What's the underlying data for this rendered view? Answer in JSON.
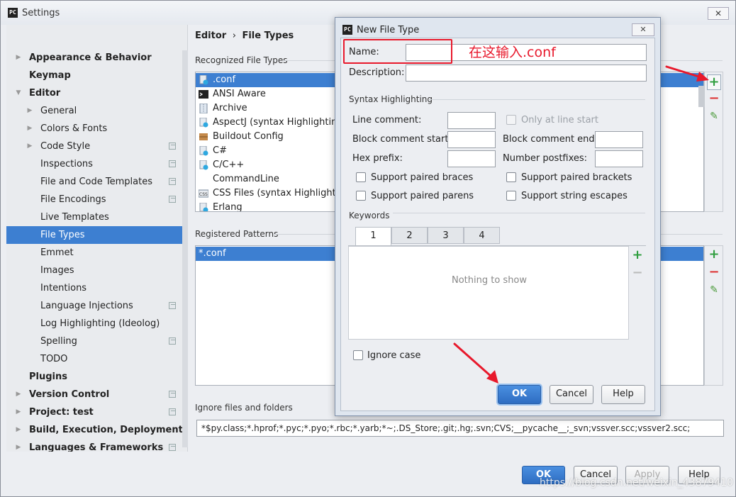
{
  "window": {
    "title": "Settings",
    "app_icon": "PC"
  },
  "search": {
    "placeholder": ""
  },
  "sidebar": {
    "items": [
      {
        "label": "Appearance & Behavior",
        "bold": true,
        "arrow": "right",
        "level": 0
      },
      {
        "label": "Keymap",
        "bold": true,
        "arrow": "",
        "level": 0
      },
      {
        "label": "Editor",
        "bold": true,
        "arrow": "down",
        "level": 0
      },
      {
        "label": "General",
        "arrow": "right",
        "level": 1
      },
      {
        "label": "Colors & Fonts",
        "arrow": "right",
        "level": 1
      },
      {
        "label": "Code Style",
        "arrow": "right",
        "level": 1,
        "copy": true
      },
      {
        "label": "Inspections",
        "level": 1,
        "copy": true
      },
      {
        "label": "File and Code Templates",
        "level": 1,
        "copy": true
      },
      {
        "label": "File Encodings",
        "level": 1,
        "copy": true
      },
      {
        "label": "Live Templates",
        "level": 1
      },
      {
        "label": "File Types",
        "level": 1,
        "selected": true
      },
      {
        "label": "Emmet",
        "level": 1
      },
      {
        "label": "Images",
        "level": 1
      },
      {
        "label": "Intentions",
        "level": 1
      },
      {
        "label": "Language Injections",
        "level": 1,
        "copy": true
      },
      {
        "label": "Log Highlighting (Ideolog)",
        "level": 1
      },
      {
        "label": "Spelling",
        "level": 1,
        "copy": true
      },
      {
        "label": "TODO",
        "level": 1
      },
      {
        "label": "Plugins",
        "bold": true,
        "level": 0
      },
      {
        "label": "Version Control",
        "bold": true,
        "arrow": "right",
        "level": 0,
        "copy": true
      },
      {
        "label": "Project: test",
        "bold": true,
        "arrow": "right",
        "level": 0,
        "copy": true
      },
      {
        "label": "Build, Execution, Deployment",
        "bold": true,
        "arrow": "right",
        "level": 0
      },
      {
        "label": "Languages & Frameworks",
        "bold": true,
        "arrow": "right",
        "level": 0,
        "copy": true
      }
    ]
  },
  "main": {
    "breadcrumb_parent": "Editor",
    "breadcrumb_sep": "›",
    "breadcrumb_current": "File Types",
    "recognized_label": "Recognized File Types",
    "file_types": [
      {
        "label": ".conf",
        "icon": "text-file-icon",
        "selected": true
      },
      {
        "label": "ANSI Aware",
        "icon": "terminal-icon"
      },
      {
        "label": "Archive",
        "icon": "archive-icon"
      },
      {
        "label": "AspectJ (syntax Highlighting O",
        "icon": "custom-file-icon"
      },
      {
        "label": "Buildout Config",
        "icon": "buildout-icon"
      },
      {
        "label": "C#",
        "icon": "custom-file-icon"
      },
      {
        "label": "C/C++",
        "icon": "custom-file-icon"
      },
      {
        "label": "CommandLine",
        "icon": ""
      },
      {
        "label": "CSS Files (syntax Highlighting",
        "icon": "css-icon"
      },
      {
        "label": "Erlang",
        "icon": "custom-file-icon"
      }
    ],
    "patterns_label": "Registered Patterns",
    "patterns": [
      {
        "label": "*.conf",
        "selected": true
      }
    ],
    "ignore_label": "Ignore files and folders",
    "ignore_value": "*$py.class;*.hprof;*.pyc;*.pyo;*.rbc;*.yarb;*~;.DS_Store;.git;.hg;.svn;CVS;__pycache__;_svn;vssver.scc;vssver2.scc;"
  },
  "footer": {
    "ok": "OK",
    "cancel": "Cancel",
    "apply": "Apply",
    "help": "Help"
  },
  "watermark": "https://blog.csdn.net/weixin_43879410",
  "dialog": {
    "title": "New File Type",
    "name_label": "Name:",
    "name_value": "",
    "description_label": "Description:",
    "description_value": "",
    "syntax_title": "Syntax Highlighting",
    "line_comment_label": "Line comment:",
    "only_line_start_label": "Only at line start",
    "block_start_label": "Block comment start:",
    "block_end_label": "Block comment end:",
    "hex_prefix_label": "Hex prefix:",
    "number_postfixes_label": "Number postfixes:",
    "paired_braces_label": "Support paired braces",
    "paired_brackets_label": "Support paired brackets",
    "paired_parens_label": "Support paired parens",
    "string_escapes_label": "Support string escapes",
    "keywords_title": "Keywords",
    "tabs": [
      "1",
      "2",
      "3",
      "4"
    ],
    "active_tab": "1",
    "empty_text": "Nothing to show",
    "ignore_case_label": "Ignore case",
    "ok": "OK",
    "cancel": "Cancel",
    "help": "Help"
  },
  "annotation": {
    "note": "在这输入.conf",
    "color": "#e8192c"
  },
  "colors": {
    "selection": "#3d7fd1",
    "primary_button": "#2e6dc2",
    "add": "#2f9e3f",
    "remove": "#d33"
  }
}
